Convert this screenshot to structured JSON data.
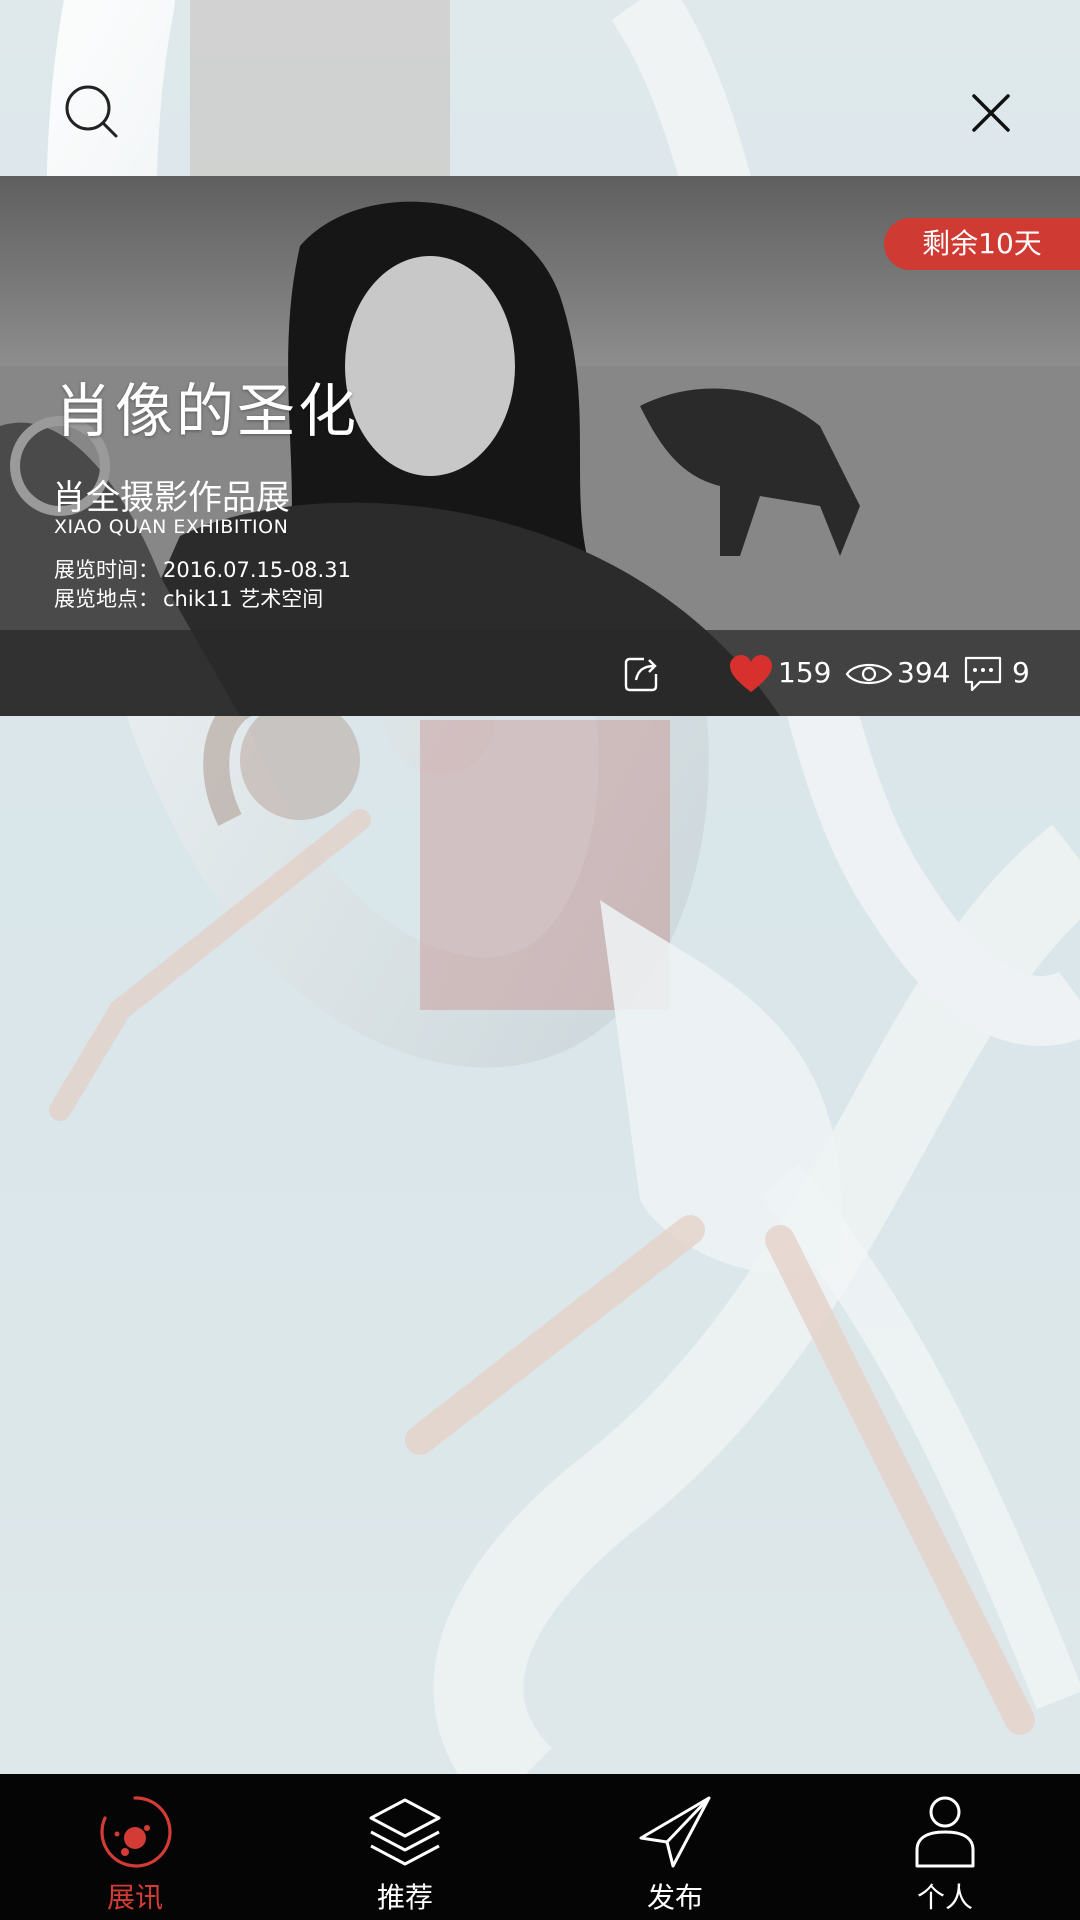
{
  "top_bar": {
    "search_icon": "search-icon",
    "close_icon": "close-icon"
  },
  "exhibition": {
    "badge": "剩余10天",
    "title": "肖像的圣化",
    "subtitle": "肖全摄影作品展",
    "subtitle_en": "XIAO QUAN EXHIBITION",
    "time_label": "展览时间：",
    "time_value": "2016.07.15-08.31",
    "location_label": "展览地点：",
    "location_value": "chik11 艺术空间",
    "likes": "159",
    "views": "394",
    "comments": "9",
    "share_icon": "share-icon",
    "like_icon": "heart-icon",
    "view_icon": "eye-icon",
    "comment_icon": "comment-icon"
  },
  "bottom_nav": {
    "items": [
      {
        "label": "展讯",
        "icon": "exhibition-icon",
        "active": true
      },
      {
        "label": "推荐",
        "icon": "layers-icon",
        "active": false
      },
      {
        "label": "发布",
        "icon": "paper-plane-icon",
        "active": false
      },
      {
        "label": "个人",
        "icon": "person-icon",
        "active": false
      }
    ]
  },
  "colors": {
    "accent": "#d23c35",
    "nav_bg": "#050505",
    "badge_bg": "#cf3a33",
    "stats_bar": "#282828"
  }
}
